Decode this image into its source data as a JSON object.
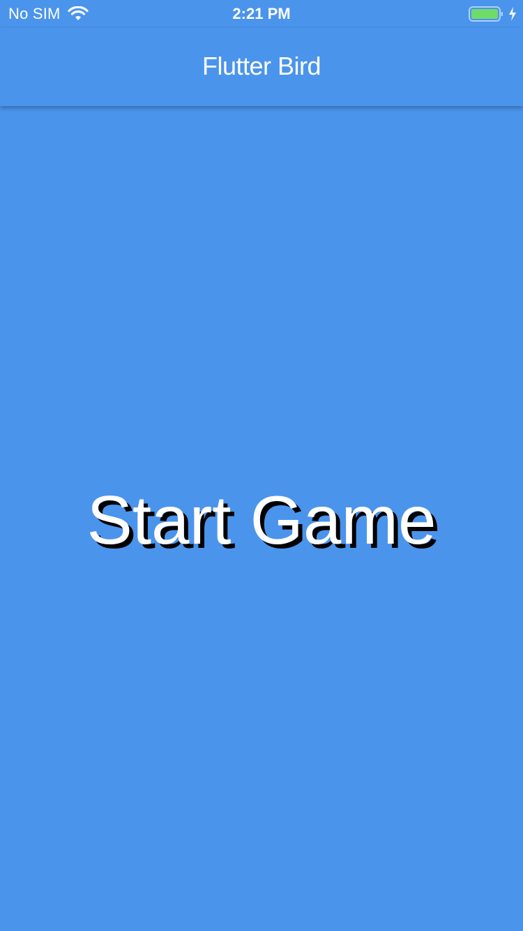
{
  "status_bar": {
    "carrier": "No SIM",
    "time": "2:21 PM",
    "wifi_icon": "wifi-icon",
    "battery_icon": "battery-full-icon",
    "charging_icon": "charging-bolt-icon",
    "battery_color": "#6fdc6a"
  },
  "app_bar": {
    "title": "Flutter Bird",
    "background": "#4a94ec"
  },
  "game": {
    "start_label": "Start Game",
    "background": "#4a94ec",
    "text_color": "#ffffff",
    "shadow_color": "#000000"
  }
}
